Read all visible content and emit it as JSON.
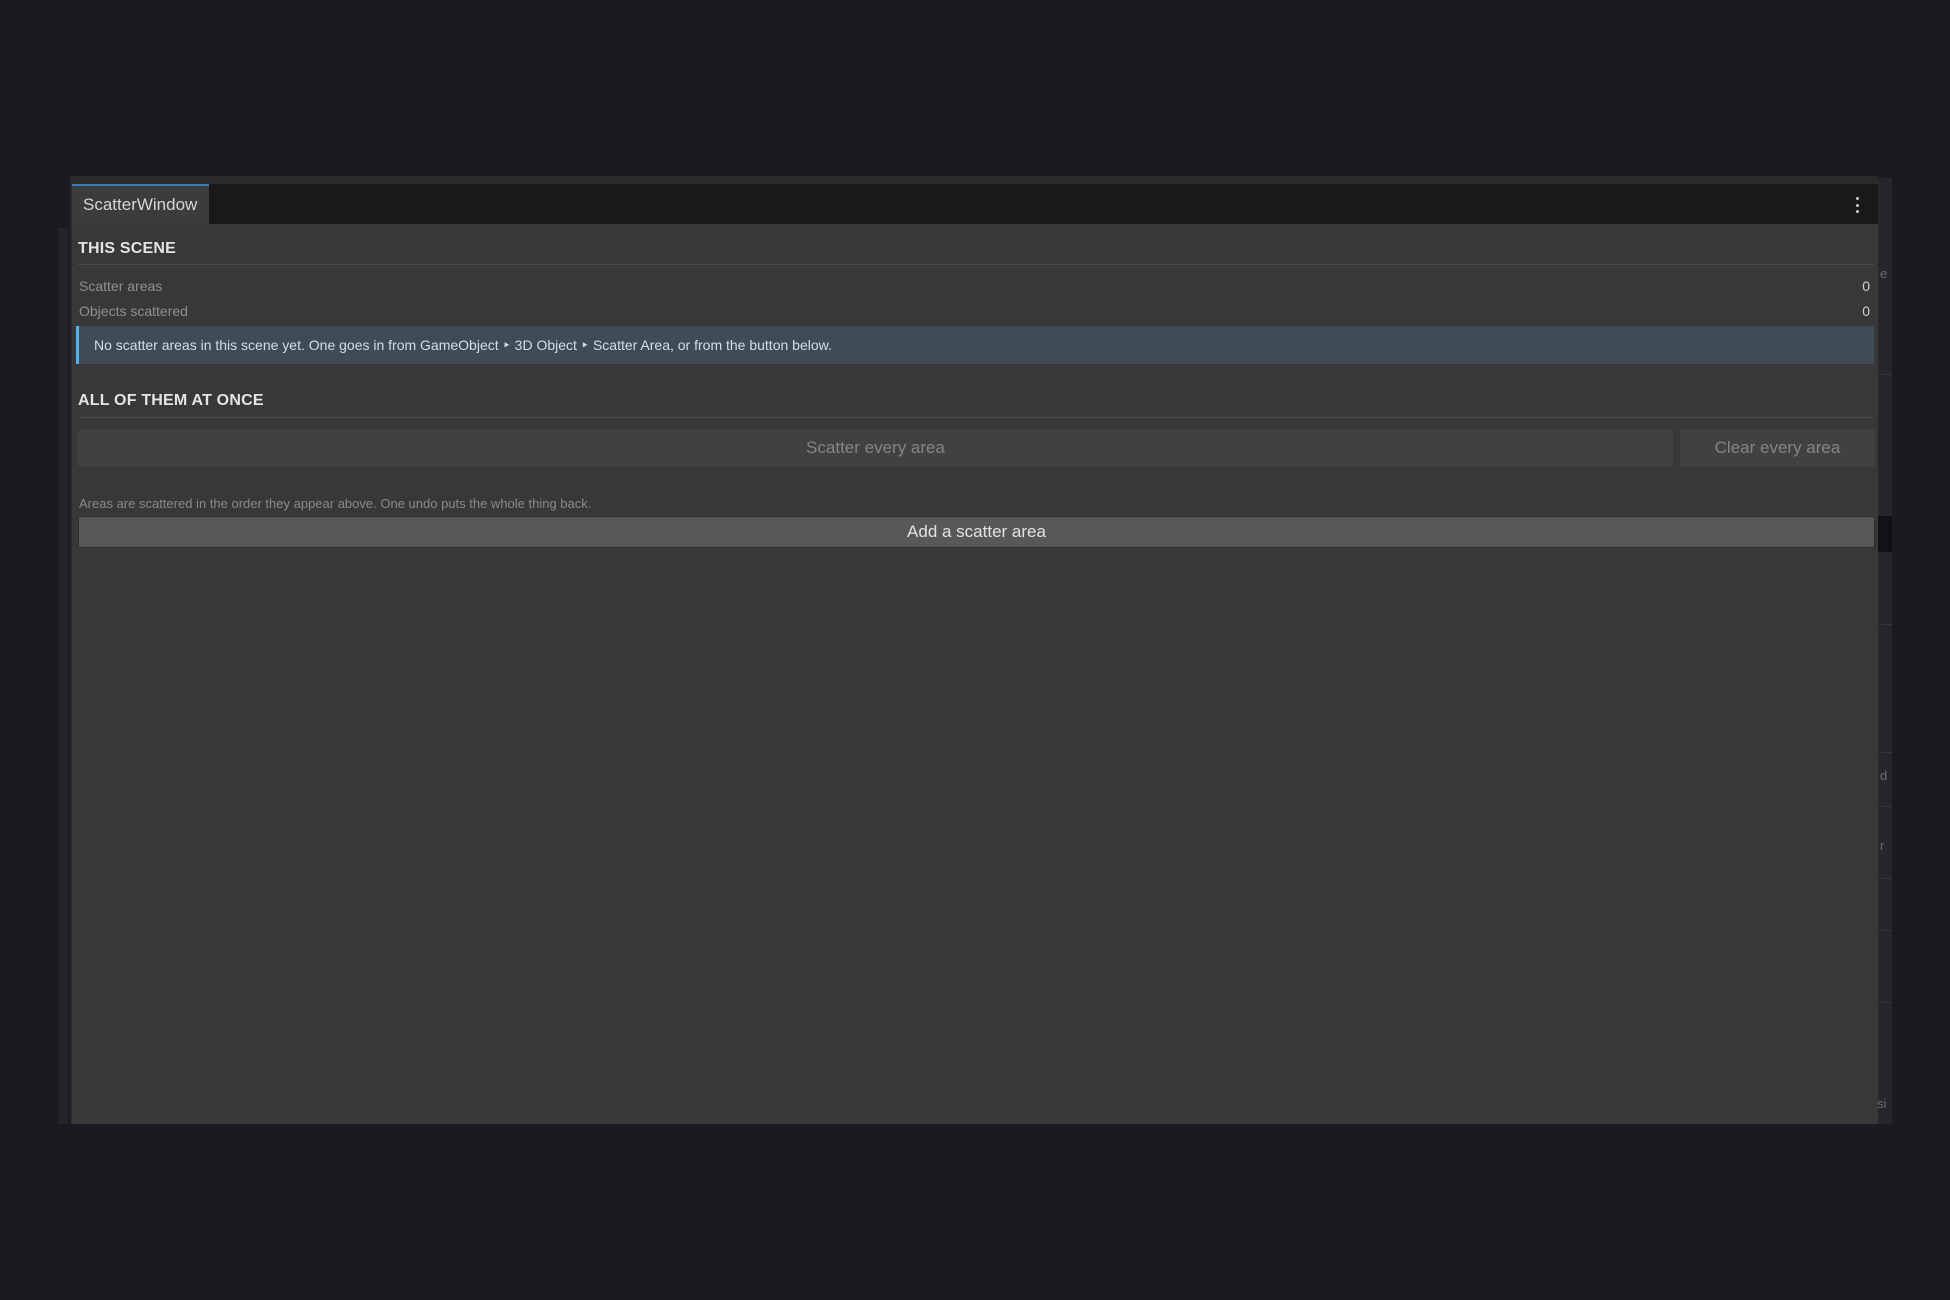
{
  "window": {
    "tab_title": "ScatterWindow",
    "menu_icon": "kebab-menu-icon"
  },
  "this_scene": {
    "heading": "THIS SCENE",
    "stats": [
      {
        "label": "Scatter areas",
        "value": "0"
      },
      {
        "label": "Objects scattered",
        "value": "0"
      }
    ],
    "info_message": "No scatter areas in this scene yet. One goes in from GameObject ‣ 3D Object ‣ Scatter Area, or from the button below."
  },
  "all_at_once": {
    "heading": "ALL OF THEM AT ONCE",
    "scatter_all_label": "Scatter every area",
    "clear_all_label": "Clear every area",
    "help_text": "Areas are scattered in the order they appear above. One undo puts the whole thing back."
  },
  "add_area_label": "Add a scatter area",
  "background_fragments": [
    "e",
    "d",
    "r",
    "si"
  ],
  "colors": {
    "info_accent": "#54b0ea",
    "tab_accent": "#3a79bb"
  }
}
